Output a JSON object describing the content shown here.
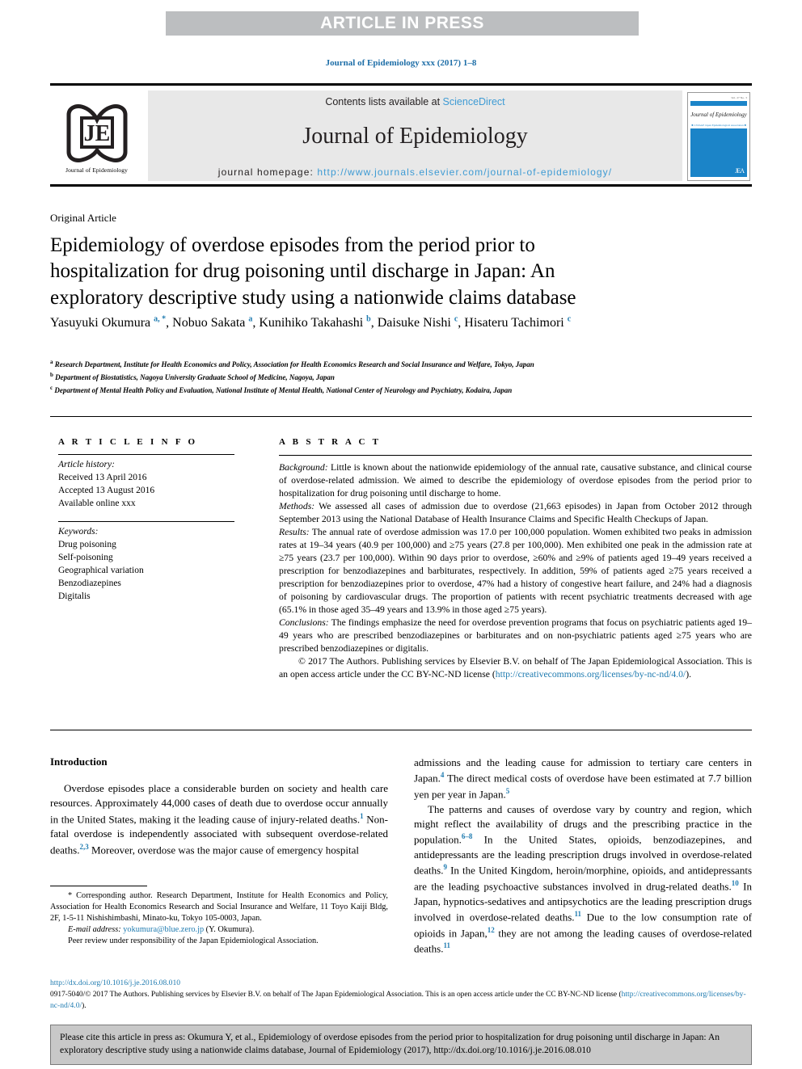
{
  "banner": {
    "text": "ARTICLE IN PRESS"
  },
  "journal_ref": "Journal of Epidemiology xxx (2017) 1–8",
  "masthead": {
    "logo_caption": "Journal of Epidemiology",
    "logo_letters": "JE",
    "contents_prefix": "Contents lists available at ",
    "contents_link": "ScienceDirect",
    "journal_title": "Journal of Epidemiology",
    "homepage_prefix": "journal homepage: ",
    "homepage_url": "http://www.journals.elsevier.com/journal-of-epidemiology/",
    "cover": {
      "issue_label": "Vol. 27 No. 3",
      "name": "Journal of Epidemiology",
      "strip": "■ J-STAGE  Japan Epidemiological Association ■",
      "mark": "JEA"
    }
  },
  "article": {
    "type": "Original Article",
    "title": "Epidemiology of overdose episodes from the period prior to hospitalization for drug poisoning until discharge in Japan: An exploratory descriptive study using a nationwide claims database",
    "authors": [
      {
        "name": "Yasuyuki Okumura",
        "sup": "a, *"
      },
      {
        "name": "Nobuo Sakata",
        "sup": "a"
      },
      {
        "name": "Kunihiko Takahashi",
        "sup": "b"
      },
      {
        "name": "Daisuke Nishi",
        "sup": "c"
      },
      {
        "name": "Hisateru Tachimori",
        "sup": "c"
      }
    ],
    "affiliations": [
      {
        "mark": "a",
        "text": "Research Department, Institute for Health Economics and Policy, Association for Health Economics Research and Social Insurance and Welfare, Tokyo, Japan"
      },
      {
        "mark": "b",
        "text": "Department of Biostatistics, Nagoya University Graduate School of Medicine, Nagoya, Japan"
      },
      {
        "mark": "c",
        "text": "Department of Mental Health Policy and Evaluation, National Institute of Mental Health, National Center of Neurology and Psychiatry, Kodaira, Japan"
      }
    ]
  },
  "article_info": {
    "heading": "A R T I C L E    I N F O",
    "history_label": "Article history:",
    "history": [
      "Received 13 April 2016",
      "Accepted 13 August 2016",
      "Available online xxx"
    ],
    "keywords_label": "Keywords:",
    "keywords": [
      "Drug poisoning",
      "Self-poisoning",
      "Geographical variation",
      "Benzodiazepines",
      "Digitalis"
    ]
  },
  "abstract": {
    "heading": "A B S T R A C T",
    "background_label": "Background:",
    "background": " Little is known about the nationwide epidemiology of the annual rate, causative substance, and clinical course of overdose-related admission. We aimed to describe the epidemiology of overdose episodes from the period prior to hospitalization for drug poisoning until discharge to home.",
    "methods_label": "Methods:",
    "methods": " We assessed all cases of admission due to overdose (21,663 episodes) in Japan from October 2012 through September 2013 using the National Database of Health Insurance Claims and Specific Health Checkups of Japan.",
    "results_label": "Results:",
    "results": " The annual rate of overdose admission was 17.0 per 100,000 population. Women exhibited two peaks in admission rates at 19–34 years (40.9 per 100,000) and ≥75 years (27.8 per 100,000). Men exhibited one peak in the admission rate at ≥75 years (23.7 per 100,000). Within 90 days prior to overdose, ≥60% and ≥9% of patients aged 19–49 years received a prescription for benzodiazepines and barbiturates, respectively. In addition, 59% of patients aged ≥75 years received a prescription for benzodiazepines prior to overdose, 47% had a history of congestive heart failure, and 24% had a diagnosis of poisoning by cardiovascular drugs. The proportion of patients with recent psychiatric treatments decreased with age (65.1% in those aged 35–49 years and 13.9% in those aged ≥75 years).",
    "conclusions_label": "Conclusions:",
    "conclusions": " The findings emphasize the need for overdose prevention programs that focus on psychiatric patients aged 19–49 years who are prescribed benzodiazepines or barbiturates and on non-psychiatric patients aged ≥75 years who are prescribed benzodiazepines or digitalis.",
    "copyright": "© 2017 The Authors. Publishing services by Elsevier B.V. on behalf of The Japan Epidemiological Association. This is an open access article under the CC BY-NC-ND license (",
    "copyright_link": "http://creativecommons.org/licenses/by-nc-nd/4.0/",
    "copyright_tail": ")."
  },
  "introduction": {
    "heading": "Introduction",
    "left_paragraphs": [
      "Overdose episodes place a considerable burden on society and health care resources. Approximately 44,000 cases of death due to overdose occur annually in the United States, making it the leading cause of injury-related deaths.|1| Non-fatal overdose is independently associated with subsequent overdose-related deaths.|2,3| Moreover, overdose was the major cause of emergency hospital"
    ],
    "right_paragraphs": [
      "admissions and the leading cause for admission to tertiary care centers in Japan.|4| The direct medical costs of overdose have been estimated at 7.7 billion yen per year in Japan.|5|",
      "The patterns and causes of overdose vary by country and region, which might reflect the availability of drugs and the prescribing practice in the population.|6–8| In the United States, opioids, benzodiazepines, and antidepressants are the leading prescription drugs involved in overdose-related deaths.|9| In the United Kingdom, heroin/morphine, opioids, and antidepressants are the leading psychoactive substances involved in drug-related deaths.|10| In Japan, hypnotics-sedatives and antipsychotics are the leading prescription drugs involved in overdose-related deaths.|11| Due to the low consumption rate of opioids in Japan,|12| they are not among the leading causes of overdose-related deaths.|11|"
    ]
  },
  "footnote": {
    "corresponding": "* Corresponding author. Research Department, Institute for Health Economics and Policy, Association for Health Economics Research and Social Insurance and Welfare, 11 Toyo Kaiji Bldg, 2F, 1-5-11 Nishishimbashi, Minato-ku, Tokyo 105-0003, Japan.",
    "email_label": "E-mail address:",
    "email": "yokumura@blue.zero.jp",
    "email_suffix": " (Y. Okumura).",
    "peer_review": "Peer review under responsibility of the Japan Epidemiological Association."
  },
  "footer": {
    "doi": "http://dx.doi.org/10.1016/j.je.2016.08.010",
    "line1_a": "0917-5040/© 2017 The Authors. Publishing services by Elsevier B.V. on behalf of The Japan Epidemiological Association. This is an open access article under the CC BY-NC-ND license (",
    "line1_link": "http://creativecommons.org/licenses/by-nc-nd/4.0/",
    "line1_b": ")."
  },
  "cite_box": {
    "text": "Please cite this article in press as: Okumura Y, et al., Epidemiology of overdose episodes from the period prior to hospitalization for drug poisoning until discharge in Japan: An exploratory descriptive study using a nationwide claims database, Journal of Epidemiology (2017), http://dx.doi.org/10.1016/j.je.2016.08.010"
  },
  "colors": {
    "link": "#1f7bb0",
    "banner_bg": "#bcbec0",
    "masthead_bg": "#e8e8e8",
    "cover_blue": "#1b84c8",
    "cite_bg": "#c8c8c8"
  }
}
